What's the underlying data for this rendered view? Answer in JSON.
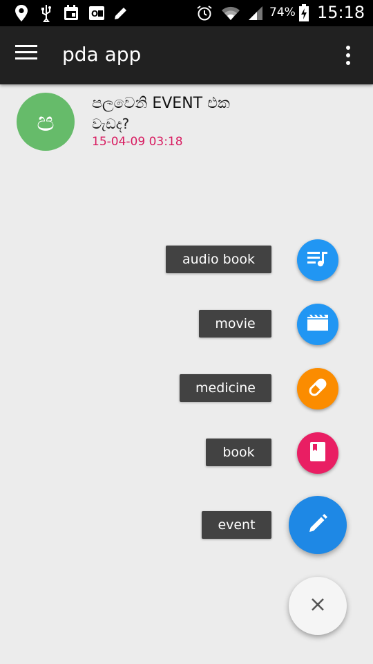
{
  "status_bar": {
    "battery_percent": "74%",
    "time": "15:18",
    "icons": [
      "location-icon",
      "usb-icon",
      "calendar-icon",
      "outlook-icon",
      "edit-icon",
      "alarm-icon",
      "wifi-icon",
      "signal-icon",
      "battery-charging-icon"
    ]
  },
  "app_bar": {
    "title": "pda app",
    "menu_icon": "hamburger-menu-icon",
    "overflow_icon": "more-vert-icon",
    "background": "#212121"
  },
  "list": {
    "items": [
      {
        "avatar_letter": "ප",
        "avatar_color": "#66bb6a",
        "title": "පලවෙනි EVENT එක",
        "subtitle": "වැඩද?",
        "date": "15-04-09 03:18",
        "date_color": "#d81b60"
      }
    ]
  },
  "fab_menu": {
    "actions": [
      {
        "label": "audio book",
        "icon": "queue-music-icon",
        "color": "#2196f3"
      },
      {
        "label": "movie",
        "icon": "movie-icon",
        "color": "#2196f3"
      },
      {
        "label": "medicine",
        "icon": "pill-icon",
        "color": "#fb8c00"
      },
      {
        "label": "book",
        "icon": "book-icon",
        "color": "#e91e63"
      },
      {
        "label": "event",
        "icon": "pencil-icon",
        "color": "#1e88e5"
      }
    ],
    "close_icon": "close-icon",
    "close_color": "#f5f5f5"
  }
}
